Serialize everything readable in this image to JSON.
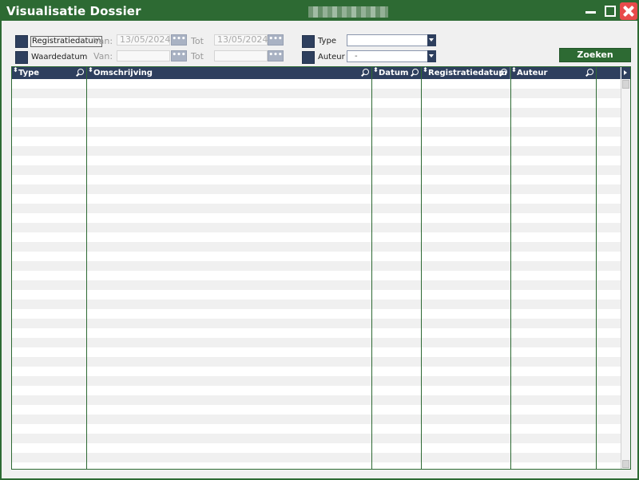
{
  "window": {
    "title": "Visualisatie Dossier"
  },
  "filters": {
    "registratiedatum": {
      "label": "Registratiedatum",
      "van_label": "Van:",
      "van_value": "13/05/2024",
      "tot_label": "Tot",
      "tot_value": "13/05/2024",
      "picker_label": "•••"
    },
    "waardedatum": {
      "label": "Waardedatum",
      "van_label": "Van:",
      "van_value": "",
      "tot_label": "Tot",
      "tot_value": "",
      "picker_label": "•••"
    },
    "type": {
      "label": "Type",
      "value": ""
    },
    "auteur": {
      "label": "Auteur",
      "value": "-"
    },
    "search_label": "Zoeken"
  },
  "grid": {
    "columns": [
      "Type",
      "Omschrijving",
      "Datum",
      "Registratiedatum",
      "Auteur"
    ],
    "rows": []
  },
  "colors": {
    "window_green": "#2d6a33",
    "header_navy": "#2e3f5e"
  }
}
